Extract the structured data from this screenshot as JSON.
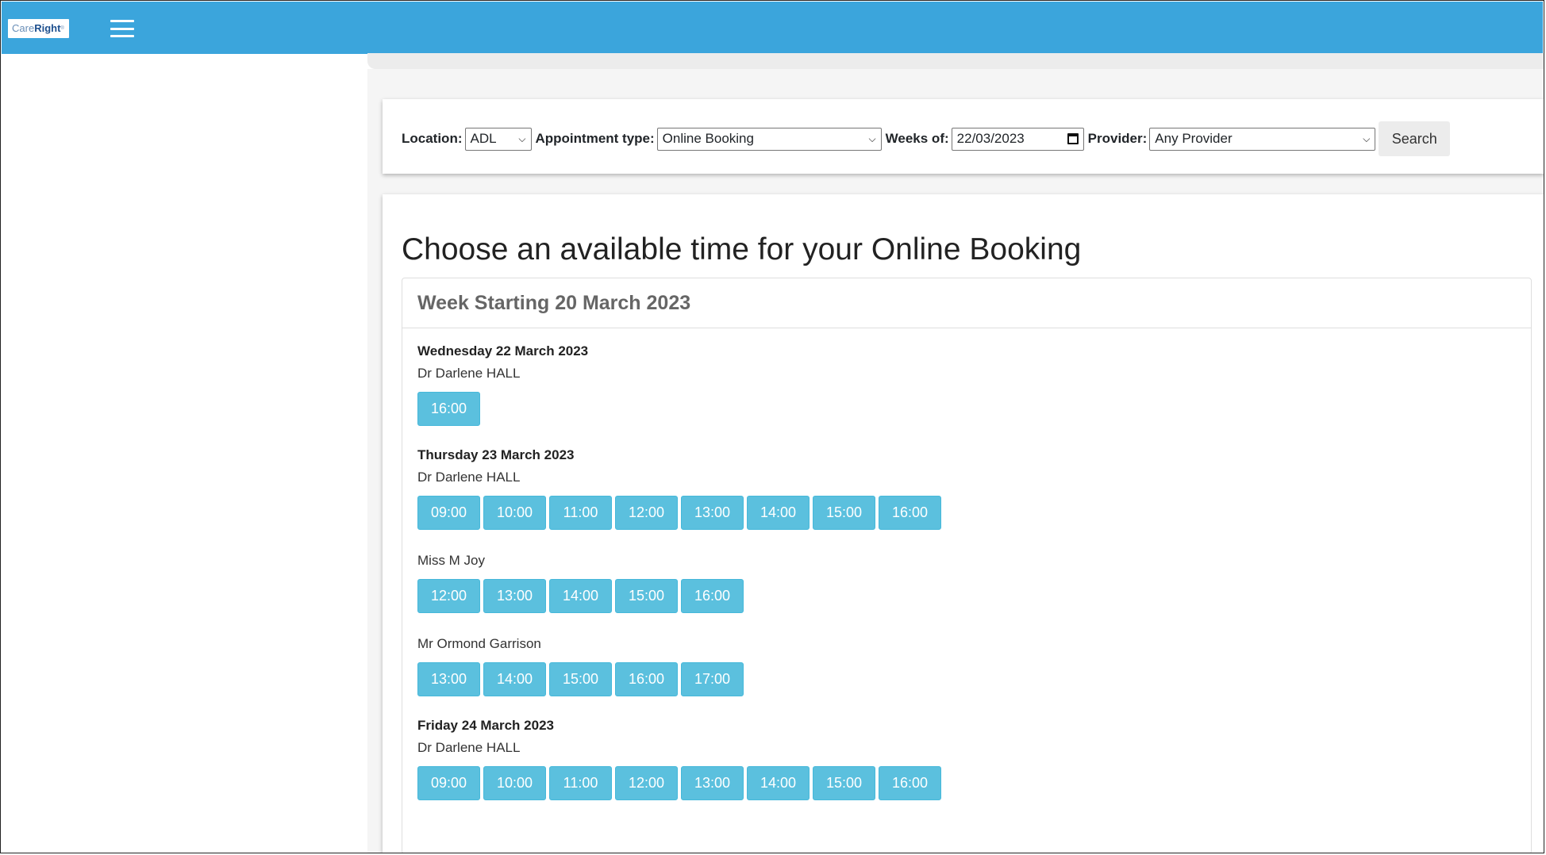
{
  "brand": {
    "logo_care": "Care",
    "logo_right": "Right",
    "logo_tm": "®"
  },
  "filters": {
    "location_label": "Location:",
    "location_value": "ADL",
    "appointment_type_label": "Appointment type:",
    "appointment_type_value": "Online Booking",
    "weeks_of_label": "Weeks of:",
    "weeks_of_value": "22/03/2023",
    "provider_label": "Provider:",
    "provider_value": "Any Provider",
    "search_label": "Search"
  },
  "main": {
    "title": "Choose an available time for your Online Booking",
    "week_header": "Week Starting 20 March 2023",
    "days": [
      {
        "title": "Wednesday 22 March 2023",
        "providers": [
          {
            "name": "Dr Darlene HALL",
            "slots": [
              "16:00"
            ]
          }
        ]
      },
      {
        "title": "Thursday 23 March 2023",
        "providers": [
          {
            "name": "Dr Darlene HALL",
            "slots": [
              "09:00",
              "10:00",
              "11:00",
              "12:00",
              "13:00",
              "14:00",
              "15:00",
              "16:00"
            ]
          },
          {
            "name": "Miss M Joy",
            "slots": [
              "12:00",
              "13:00",
              "14:00",
              "15:00",
              "16:00"
            ]
          },
          {
            "name": "Mr Ormond Garrison",
            "slots": [
              "13:00",
              "14:00",
              "15:00",
              "16:00",
              "17:00"
            ]
          }
        ]
      },
      {
        "title": "Friday 24 March 2023",
        "providers": [
          {
            "name": "Dr Darlene HALL",
            "slots": [
              "09:00",
              "10:00",
              "11:00",
              "12:00",
              "13:00",
              "14:00",
              "15:00",
              "16:00"
            ]
          }
        ]
      }
    ]
  },
  "colors": {
    "topbar": "#3ba5dc",
    "slot_button": "#5bc0de"
  }
}
